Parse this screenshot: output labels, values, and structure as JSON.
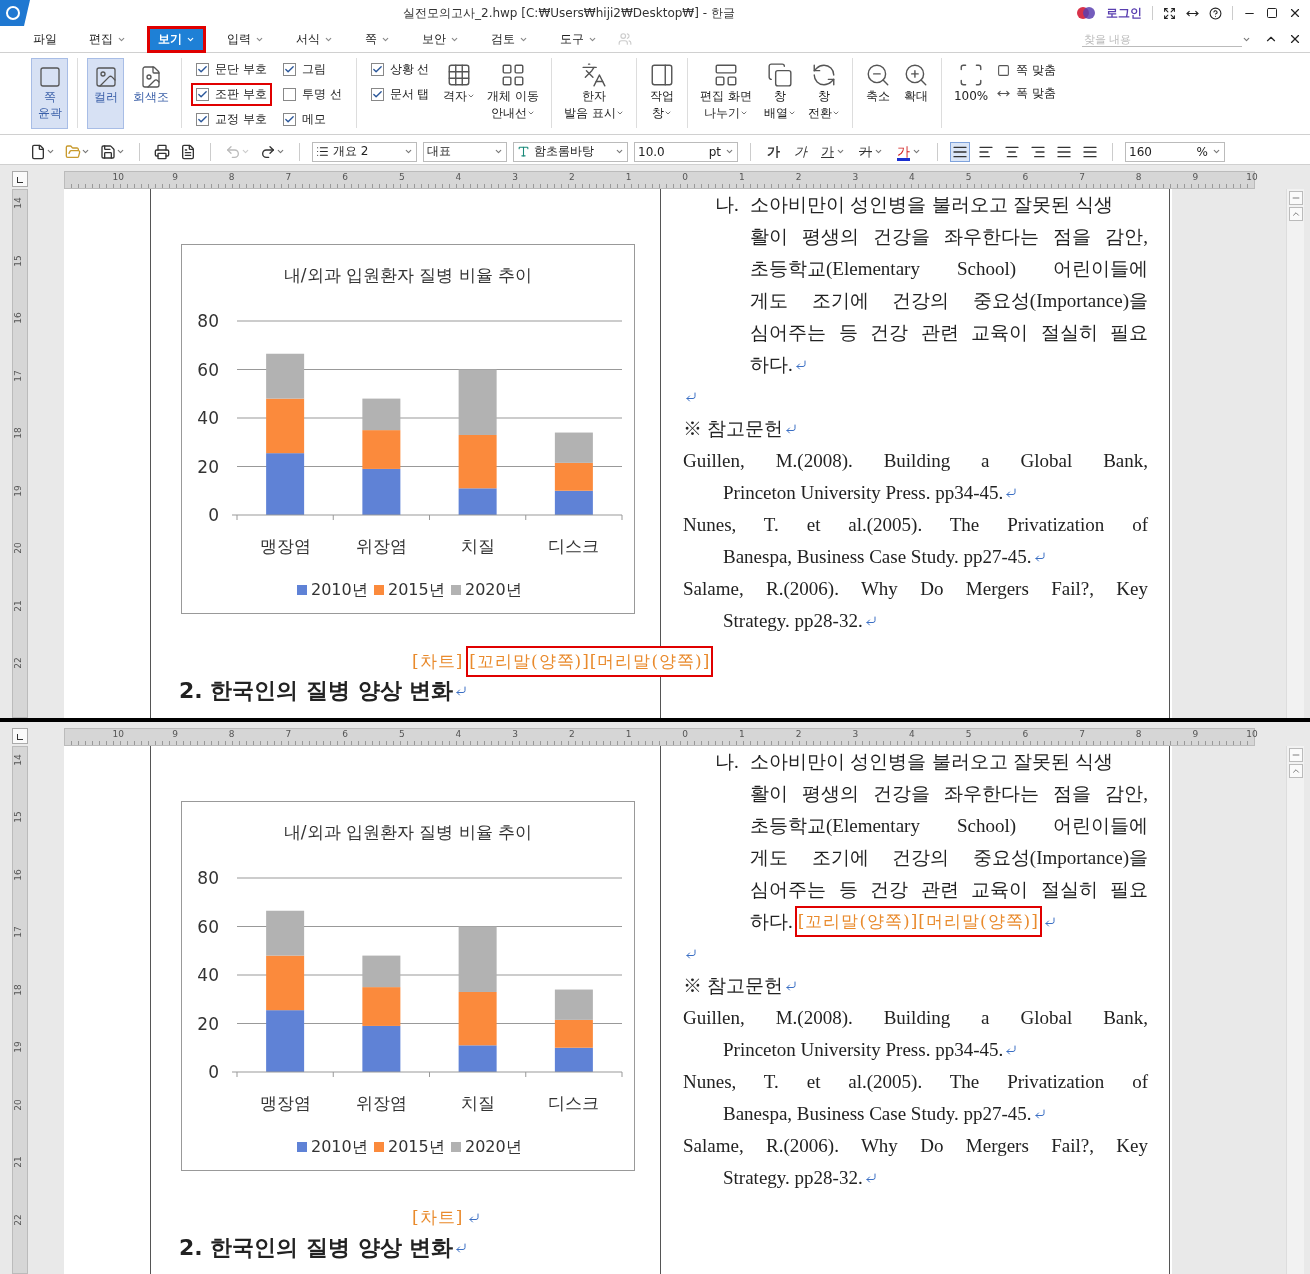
{
  "window": {
    "title": "실전모의고사_2.hwp [C:₩Users₩hiji2₩Desktop₩] - 한글",
    "login": "로그인"
  },
  "menu": [
    {
      "label": "파일",
      "dropdown": false,
      "selected": false,
      "highlighted": false
    },
    {
      "label": "편집",
      "dropdown": true,
      "selected": false,
      "highlighted": false
    },
    {
      "label": "보기",
      "dropdown": true,
      "selected": true,
      "highlighted": true
    },
    {
      "label": "입력",
      "dropdown": true,
      "selected": false,
      "highlighted": false
    },
    {
      "label": "서식",
      "dropdown": true,
      "selected": false,
      "highlighted": false
    },
    {
      "label": "쪽",
      "dropdown": true,
      "selected": false,
      "highlighted": false
    },
    {
      "label": "보안",
      "dropdown": true,
      "selected": false,
      "highlighted": false
    },
    {
      "label": "검토",
      "dropdown": true,
      "selected": false,
      "highlighted": false
    },
    {
      "label": "도구",
      "dropdown": true,
      "selected": false,
      "highlighted": false
    }
  ],
  "search": {
    "placeholder": "찾을 내용"
  },
  "ribbon": {
    "groups": [
      {
        "buttons": [
          {
            "label": "쪽\n윤곽",
            "selected": true
          }
        ]
      },
      {
        "buttons": [
          {
            "label": "컬러",
            "selected": true
          },
          {
            "label": "회색조",
            "selected": false
          }
        ]
      },
      {
        "columns": [
          [
            {
              "label": "문단 부호",
              "checked": true,
              "highlighted": false
            },
            {
              "label": "조판 부호",
              "checked": true,
              "highlighted": true
            },
            {
              "label": "교정 부호",
              "checked": true,
              "highlighted": false
            }
          ],
          [
            {
              "label": "그림",
              "checked": true,
              "highlighted": false
            },
            {
              "label": "투명 선",
              "checked": false,
              "highlighted": false
            },
            {
              "label": "메모",
              "checked": true,
              "highlighted": false
            }
          ]
        ]
      },
      {
        "columns": [
          [
            {
              "label": "상황 선",
              "checked": true,
              "highlighted": false
            },
            {
              "label": "문서 탭",
              "checked": true,
              "highlighted": false
            }
          ]
        ],
        "tools": [
          {
            "label": "격자",
            "dropdown": true
          },
          {
            "label": "개체 이동\n안내선",
            "dropdown": true
          }
        ]
      },
      {
        "tools": [
          {
            "label": "한자\n발음 표시",
            "dropdown": true
          }
        ]
      },
      {
        "tools": [
          {
            "label": "작업\n창",
            "dropdown": true
          }
        ]
      },
      {
        "tools": [
          {
            "label": "편집 화면\n나누기",
            "dropdown": true
          },
          {
            "label": "창\n배열",
            "dropdown": true
          },
          {
            "label": "창\n전환",
            "dropdown": true
          }
        ]
      },
      {
        "tools": [
          {
            "label": "축소",
            "dropdown": false
          },
          {
            "label": "확대",
            "dropdown": false
          }
        ]
      },
      {
        "tools": [
          {
            "label": "100%",
            "dropdown": false
          }
        ],
        "fit_buttons": [
          "쪽 맞춤",
          "폭 맞춤"
        ]
      }
    ]
  },
  "toolbar": {
    "history": [
      {
        "disabled": true
      },
      {
        "disabled": false
      }
    ],
    "style": "개요 2",
    "category": "대표",
    "font": "함초롬바탕",
    "size": {
      "value": "10.0",
      "unit": "pt"
    },
    "format_buttons": [
      {
        "text": "가",
        "kind": "bold",
        "dropdown": false
      },
      {
        "text": "가",
        "kind": "italic",
        "dropdown": false
      },
      {
        "text": "가",
        "kind": "underline",
        "dropdown": true
      },
      {
        "text": "가",
        "kind": "outline",
        "dropdown": true
      },
      {
        "text": "가",
        "kind": "color",
        "dropdown": true
      }
    ],
    "alignment": [
      {
        "selected": true
      },
      {
        "selected": false
      },
      {
        "selected": false
      },
      {
        "selected": false
      },
      {
        "selected": false
      },
      {
        "selected": false
      }
    ],
    "line_spacing": {
      "value": "160",
      "unit": "%"
    }
  },
  "panes": [
    {
      "ruler": {
        "horizontal": [
          "10",
          "9",
          "8",
          "7",
          "6",
          "5",
          "4",
          "3",
          "2",
          "1",
          "0",
          "1",
          "2",
          "3",
          "4",
          "5",
          "6",
          "7",
          "8",
          "9",
          "10"
        ],
        "vertical": [
          "14",
          "15",
          "16",
          "17",
          "18",
          "19",
          "20",
          "21",
          "22"
        ]
      },
      "chart_data": {
        "type": "bar",
        "stacked": true,
        "grid": true,
        "legend": true,
        "title": "내/외과 입원환자 질병 비율 추이",
        "categories": [
          "맹장염",
          "위장염",
          "치질",
          "디스크"
        ],
        "ylim": [
          0,
          80
        ],
        "yticks": [
          0,
          20,
          40,
          60,
          80
        ],
        "series": [
          {
            "name": "2010년",
            "color": "#5f82d6",
            "values": [
              25.5,
              19,
              11,
              10
            ]
          },
          {
            "name": "2015년",
            "color": "#fb8a3c",
            "values": [
              22.5,
              16,
              22,
              11.5
            ]
          },
          {
            "name": "2020년",
            "color": "#b2b2b2",
            "values": [
              18.5,
              13,
              27,
              12.5
            ]
          }
        ]
      },
      "caption": [
        {
          "text": "[차트]",
          "highlighted": false
        },
        {
          "text": "[꼬리말(양쪽)][머리말(양쪽)]",
          "highlighted": true
        }
      ],
      "heading": "2. 한국인의 질병 양상 변화",
      "list_item": {
        "marker": "나.",
        "lines": [
          "소아비만이 성인병을 불러오고 잘못된 식생",
          "활이 평생의 건강을 좌우한다는 점을 감안,",
          "초등학교(Elementary School) 어린이들에",
          "게도 조기에 건강의 중요성(Importance)을",
          "심어주는 등 건강 관련 교육이 절실히 필요",
          "하다."
        ]
      },
      "references_title": "※ 참고문헌",
      "references": [
        {
          "lines": [
            "Guillen, M.(2008). Building a Global Bank,",
            "Princeton University Press. pp34-45."
          ]
        },
        {
          "lines": [
            "Nunes, T. et al.(2005). The Privatization of",
            "Banespa, Business Case Study. pp27-45."
          ]
        },
        {
          "lines": [
            "Salame, R.(2006). Why Do Mergers Fail?, Key",
            "Strategy. pp28-32."
          ]
        }
      ]
    },
    {
      "ruler": {
        "horizontal": [
          "10",
          "9",
          "8",
          "7",
          "6",
          "5",
          "4",
          "3",
          "2",
          "1",
          "0",
          "1",
          "2",
          "3",
          "4",
          "5",
          "6",
          "7",
          "8",
          "9",
          "10"
        ],
        "vertical": [
          "14",
          "15",
          "16",
          "17",
          "18",
          "19",
          "20",
          "21",
          "22"
        ]
      },
      "chart_data": {
        "type": "bar",
        "stacked": true,
        "grid": true,
        "legend": true,
        "title": "내/외과 입원환자 질병 비율 추이",
        "categories": [
          "맹장염",
          "위장염",
          "치질",
          "디스크"
        ],
        "ylim": [
          0,
          80
        ],
        "yticks": [
          0,
          20,
          40,
          60,
          80
        ],
        "series": [
          {
            "name": "2010년",
            "color": "#5f82d6",
            "values": [
              25.5,
              19,
              11,
              10
            ]
          },
          {
            "name": "2015년",
            "color": "#fb8a3c",
            "values": [
              22.5,
              16,
              22,
              11.5
            ]
          },
          {
            "name": "2020년",
            "color": "#b2b2b2",
            "values": [
              18.5,
              13,
              27,
              12.5
            ]
          }
        ]
      },
      "caption": [
        {
          "text": "[차트]",
          "highlighted": false
        }
      ],
      "heading": "2. 한국인의 질병 양상 변화",
      "list_item": {
        "marker": "나.",
        "lines": [
          "소아비만이 성인병을 불러오고 잘못된 식생",
          "활이 평생의 건강을 좌우한다는 점을 감안,",
          "초등학교(Elementary School) 어린이들에",
          "게도 조기에 건강의 중요성(Importance)을",
          "심어주는 등 건강 관련 교육이 절실히 필요",
          "하다."
        ],
        "tail": {
          "text": "[꼬리말(양쪽)][머리말(양쪽)]",
          "highlighted": true
        }
      },
      "references_title": "※ 참고문헌",
      "references": [
        {
          "lines": [
            "Guillen, M.(2008). Building a Global Bank,",
            "Princeton University Press. pp34-45."
          ]
        },
        {
          "lines": [
            "Nunes, T. et al.(2005). The Privatization of",
            "Banespa, Business Case Study. pp27-45."
          ]
        },
        {
          "lines": [
            "Salame, R.(2006). Why Do Mergers Fail?, Key",
            "Strategy. pp28-32."
          ]
        }
      ]
    }
  ]
}
